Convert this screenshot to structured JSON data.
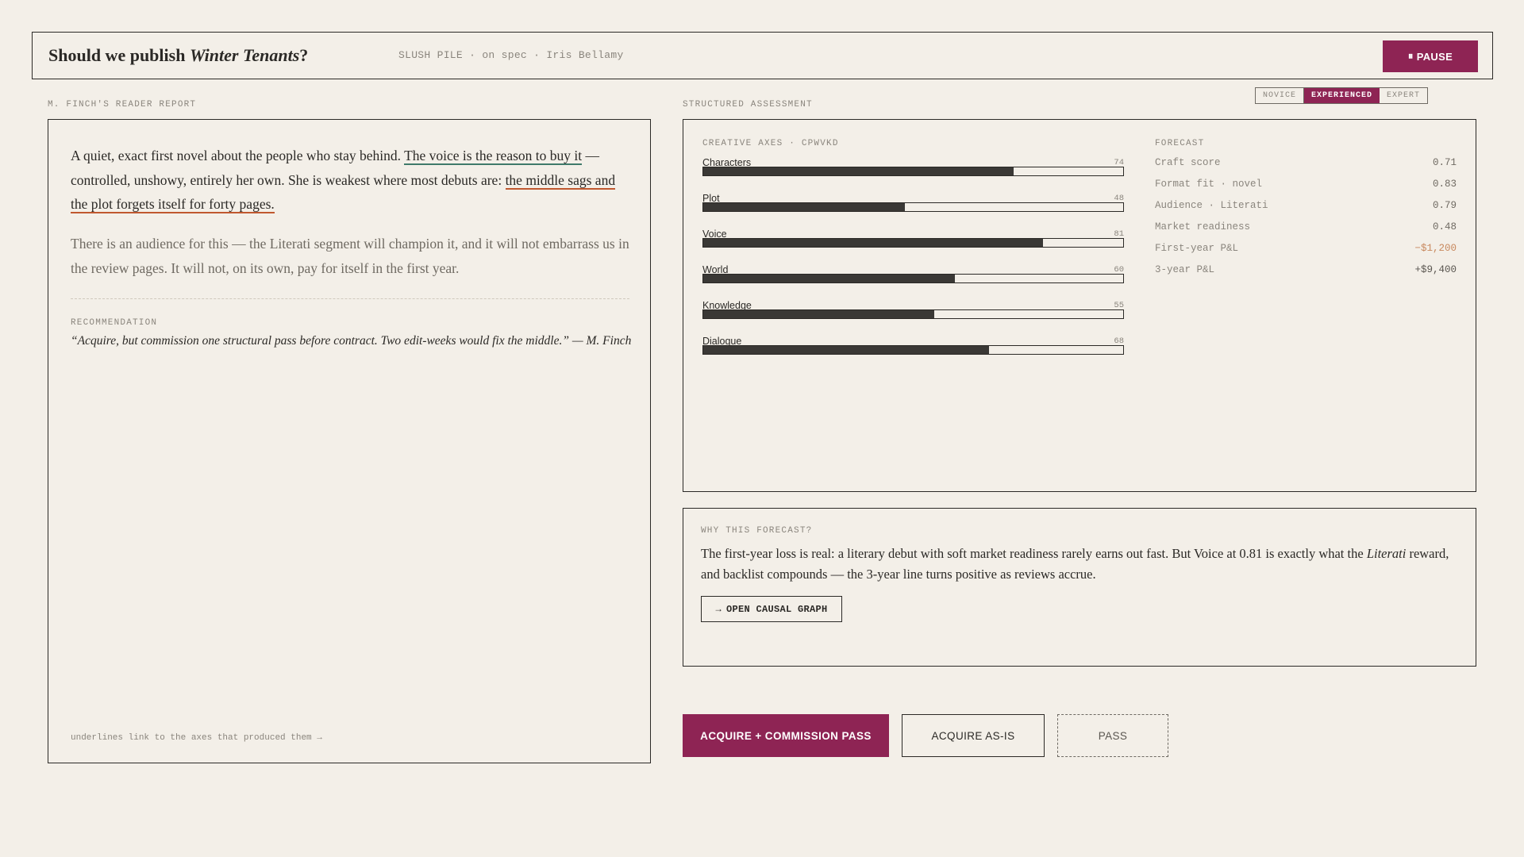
{
  "header": {
    "title_prefix": "Should we publish ",
    "title_book": "Winter Tenants",
    "title_suffix": "?",
    "meta": "SLUSH PILE · on spec · Iris Bellamy",
    "pause_icon": "pause-icon",
    "pause_label": "PAUSE"
  },
  "report": {
    "section_label": "M. FINCH'S READER REPORT",
    "lead_1": "A quiet, exact first novel about the people who stay behind. ",
    "lead_link_1": "The voice is the reason to buy it",
    "lead_2": " — controlled, unshowy, entirely her own. She is weakest where most debuts are: ",
    "lead_link_2": "the middle sags and the plot forgets itself for forty pages.",
    "second": "There is an audience for this — the Literati segment will champion it, and it will not embarrass us in the review pages. It will not, on its own, pay for itself in the first year.",
    "rec_label": "RECOMMENDATION",
    "rec_quote": "“Acquire, but commission one structural pass before contract. Two edit-weeks would fix the middle.” — M. Finch",
    "footnote": "underlines link to the axes that produced them →"
  },
  "assessment": {
    "section_label": "STRUCTURED ASSESSMENT",
    "levels": [
      "NOVICE",
      "EXPERIENCED",
      "EXPERT"
    ],
    "active_level": "EXPERIENCED",
    "axes_label": "CREATIVE AXES · CPWVKD",
    "axes": [
      {
        "name": "Characters",
        "value": 74
      },
      {
        "name": "Plot",
        "value": 48
      },
      {
        "name": "Voice",
        "value": 81
      },
      {
        "name": "World",
        "value": 60
      },
      {
        "name": "Knowledge",
        "value": 55
      },
      {
        "name": "Dialogue",
        "value": 68
      }
    ],
    "forecast_label": "FORECAST",
    "forecast": [
      {
        "key": "Craft score",
        "value": "0.71",
        "tone": "plain"
      },
      {
        "key": "Format fit · novel",
        "value": "0.83",
        "tone": "plain"
      },
      {
        "key": "Audience · Literati",
        "value": "0.79",
        "tone": "plain"
      },
      {
        "key": "Market readiness",
        "value": "0.48",
        "tone": "plain"
      },
      {
        "key": "First-year P&L",
        "value": "−$1,200",
        "tone": "neg"
      },
      {
        "key": "3-year P&L",
        "value": "+$9,400",
        "tone": "pos"
      }
    ]
  },
  "why": {
    "label": "WHY THIS FORECAST?",
    "text_1": "The first-year loss is real: a literary debut with soft market readiness rarely earns out fast. But Voice at 0.81 is exactly what the ",
    "text_em": "Literati",
    "text_2": " reward, and backlist compounds — the 3-year line turns positive as reviews accrue.",
    "button_arrow": "→",
    "button_label": "OPEN CAUSAL GRAPH"
  },
  "actions": {
    "primary": "ACQUIRE + COMMISSION PASS",
    "secondary": "ACQUIRE AS-IS",
    "tertiary": "PASS"
  },
  "colors": {
    "accent": "#8e2454",
    "background": "#f3efe8",
    "ink": "#2b2926",
    "underline_positive": "#3f7a6a",
    "underline_negative": "#c0582f"
  }
}
